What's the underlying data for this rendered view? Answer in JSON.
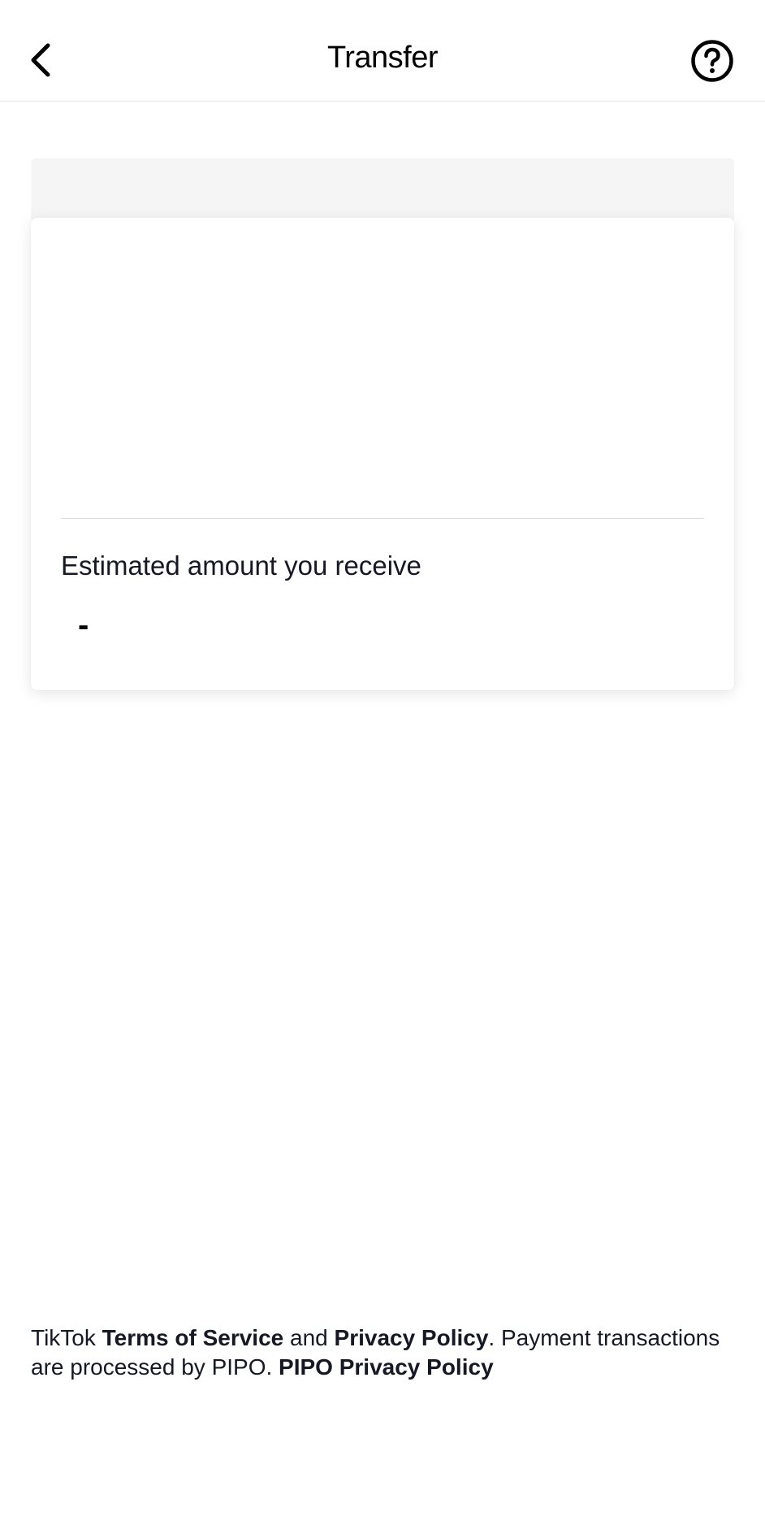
{
  "header": {
    "title": "Transfer",
    "back_icon": "chevron-left-icon",
    "help_icon": "question-circle-icon"
  },
  "card": {
    "estimated_label": "Estimated amount you receive",
    "estimated_value": "-"
  },
  "footer": {
    "prefix": "TikTok ",
    "terms_link": "Terms of Service",
    "and_text": " and ",
    "privacy_link": "Privacy Policy",
    "middle_text": ". Payment transactions are processed by PIPO. ",
    "pipo_link": "PIPO Privacy Policy"
  },
  "colors": {
    "text": "#161823",
    "divider": "#e3e3e4",
    "strip": "#f5f5f5"
  }
}
